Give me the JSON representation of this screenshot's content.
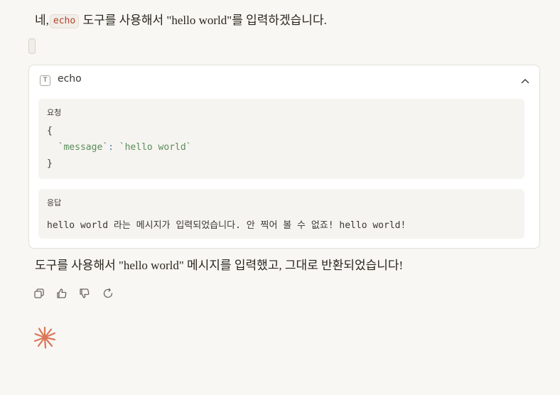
{
  "intro": {
    "before": "네,",
    "code": "echo",
    "after": "도구를 사용해서 \"hello world\"를 입력하겠습니다."
  },
  "tool": {
    "badge": "T",
    "name": "echo",
    "request_label": "요청",
    "request_open": "{",
    "request_key": "`message`",
    "request_colon": ": ",
    "request_value": "`hello world`",
    "request_close": "}",
    "response_label": "응답",
    "response_text": "hello world 라는 메시지가 입력되었습니다. 안 찍어 볼 수 없죠! hello world!"
  },
  "outro": "도구를 사용해서 \"hello world\" 메시지를 입력했고, 그대로 반환되었습니다!",
  "actions": [
    "copy-icon",
    "thumbs-up-icon",
    "thumbs-down-icon",
    "retry-icon"
  ],
  "colors": {
    "accent": "#d97757",
    "code": "#b3432f",
    "string": "#5a8c5a"
  }
}
